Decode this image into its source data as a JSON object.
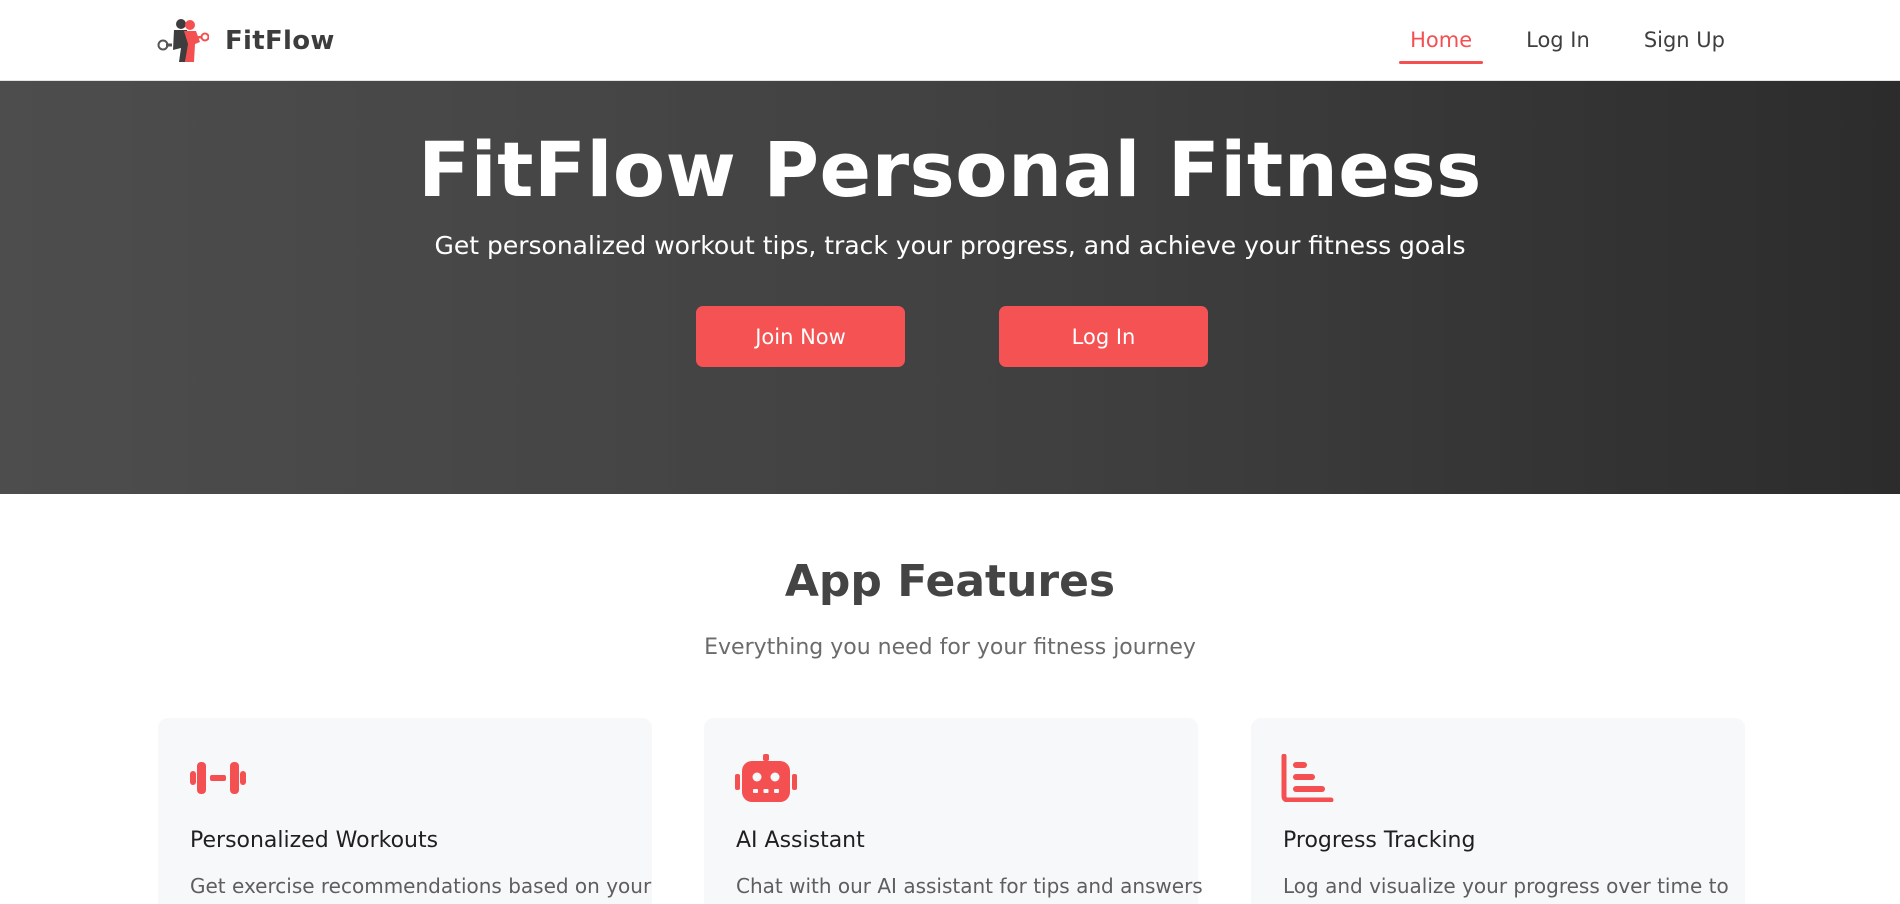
{
  "brand": {
    "name": "FitFlow",
    "logo_icon": "fitness-figure-logo"
  },
  "nav": {
    "items": [
      {
        "label": "Home",
        "active": true
      },
      {
        "label": "Log In",
        "active": false
      },
      {
        "label": "Sign Up",
        "active": false
      }
    ]
  },
  "hero": {
    "title": "FitFlow Personal Fitness",
    "subtitle": "Get personalized workout tips, track your progress, and achieve your fitness goals",
    "buttons": {
      "join": "Join Now",
      "login": "Log In"
    }
  },
  "features": {
    "title": "App Features",
    "subtitle": "Everything you need for your fitness journey",
    "cards": [
      {
        "icon": "dumbbell-icon",
        "title": "Personalized Workouts",
        "description": "Get exercise recommendations based on your"
      },
      {
        "icon": "robot-icon",
        "title": "AI Assistant",
        "description": "Chat with our AI assistant for tips and answers"
      },
      {
        "icon": "chart-bar-icon",
        "title": "Progress Tracking",
        "description": "Log and visualize your progress over time to"
      }
    ]
  },
  "colors": {
    "accent": "#f55253",
    "hero_dark": "#2c2c2c",
    "hero_light": "#4d4d4d",
    "card_bg": "#f7f8fa"
  }
}
